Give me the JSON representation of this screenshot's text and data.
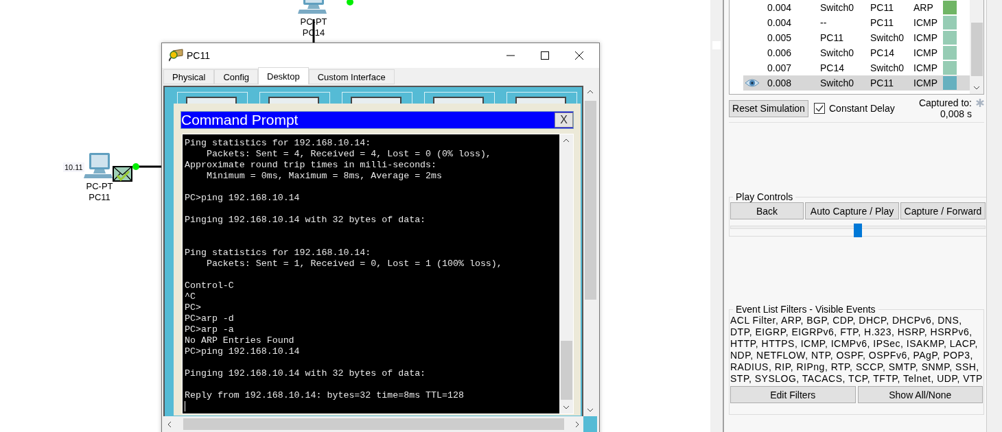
{
  "canvas": {
    "nodes": [
      {
        "model": "PC-PT",
        "name": "PC14",
        "has_pdu": false
      },
      {
        "model": "PC-PT",
        "name": "PC11",
        "address": "10.11",
        "has_pdu": true
      }
    ]
  },
  "device_window": {
    "title": "PC11",
    "tabs": [
      {
        "label": "Physical",
        "selected": false
      },
      {
        "label": "Config",
        "selected": false
      },
      {
        "label": "Desktop",
        "selected": true
      },
      {
        "label": "Custom Interface",
        "selected": false
      }
    ],
    "command_prompt": {
      "title": "Command Prompt",
      "close": "X",
      "lines": [
        {
          "kind": "text",
          "text": "Ping statistics for 192.168.10.14:"
        },
        {
          "kind": "text",
          "text": "    Packets: Sent = 4, Received = 4, Lost = 0 (0% loss),"
        },
        {
          "kind": "text",
          "text": "Approximate round trip times in milli-seconds:"
        },
        {
          "kind": "text",
          "text": "    Minimum = 0ms, Maximum = 8ms, Average = 2ms"
        },
        {
          "kind": "blank"
        },
        {
          "kind": "text",
          "text": "PC>ping 192.168.10.14"
        },
        {
          "kind": "blank"
        },
        {
          "kind": "text",
          "text": "Pinging 192.168.10.14 with 32 bytes of data:"
        },
        {
          "kind": "blank"
        },
        {
          "kind": "blank"
        },
        {
          "kind": "text",
          "text": "Ping statistics for 192.168.10.14:"
        },
        {
          "kind": "text",
          "text": "    Packets: Sent = 1, Received = 0, Lost = 1 (100% loss),"
        },
        {
          "kind": "blank"
        },
        {
          "kind": "text",
          "text": "Control-C"
        },
        {
          "kind": "text",
          "text": "^C"
        },
        {
          "kind": "text",
          "text": "PC>"
        },
        {
          "kind": "text",
          "text": "PC>arp -d"
        },
        {
          "kind": "text",
          "text": "PC>arp -a"
        },
        {
          "kind": "text",
          "text": "No ARP Entries Found"
        },
        {
          "kind": "text",
          "text": "PC>ping 192.168.10.14"
        },
        {
          "kind": "blank"
        },
        {
          "kind": "text",
          "text": "Pinging 192.168.10.14 with 32 bytes of data:"
        },
        {
          "kind": "blank"
        },
        {
          "kind": "text",
          "text": "Reply from 192.168.10.14: bytes=32 time=8ms TTL=128"
        }
      ]
    }
  },
  "event_list": {
    "rows": [
      {
        "time": "0.004",
        "last_device": "Switch0",
        "at_device": "PC11",
        "type": "ARP",
        "color": "#70b565",
        "selected": false
      },
      {
        "time": "0.004",
        "last_device": "--",
        "at_device": "PC11",
        "type": "ICMP",
        "color": "#96ccb4",
        "selected": false
      },
      {
        "time": "0.005",
        "last_device": "PC11",
        "at_device": "Switch0",
        "type": "ICMP",
        "color": "#96ccb4",
        "selected": false
      },
      {
        "time": "0.006",
        "last_device": "Switch0",
        "at_device": "PC14",
        "type": "ICMP",
        "color": "#96ccb4",
        "selected": false
      },
      {
        "time": "0.007",
        "last_device": "PC14",
        "at_device": "Switch0",
        "type": "ICMP",
        "color": "#96ccb4",
        "selected": false
      },
      {
        "time": "0.008",
        "last_device": "Switch0",
        "at_device": "PC11",
        "type": "ICMP",
        "color": "#66b0bf",
        "selected": true
      }
    ]
  },
  "simulation": {
    "reset": "Reset Simulation",
    "constant_delay": {
      "label": "Constant Delay",
      "checked": true
    },
    "captured_label": "Captured to:",
    "captured_value": "0,008 s"
  },
  "play_controls": {
    "title": "Play Controls",
    "buttons": [
      "Back",
      "Auto Capture / Play",
      "Capture / Forward"
    ],
    "speed": {
      "level": 0.5
    }
  },
  "event_filters": {
    "title": "Event List Filters - Visible Events",
    "protocols": "ACL Filter, ARP, BGP, CDP, DHCP, DHCPv6, DNS, DTP, EIGRP, EIGRPv6, FTP, H.323, HSRP, HSRPv6, HTTP, HTTPS, ICMP, ICMPv6, IPSec, ISAKMP, LACP, NDP, NETFLOW, NTP, OSPF, OSPFv6, PAgP, POP3, RADIUS, RIP, RIPng, RTP, SCCP, SMTP, SNMP, SSH, STP, SYSLOG, TACACS, TCP, TFTP, Telnet, UDP, VTP",
    "buttons": [
      "Edit Filters",
      "Show All/None"
    ]
  }
}
